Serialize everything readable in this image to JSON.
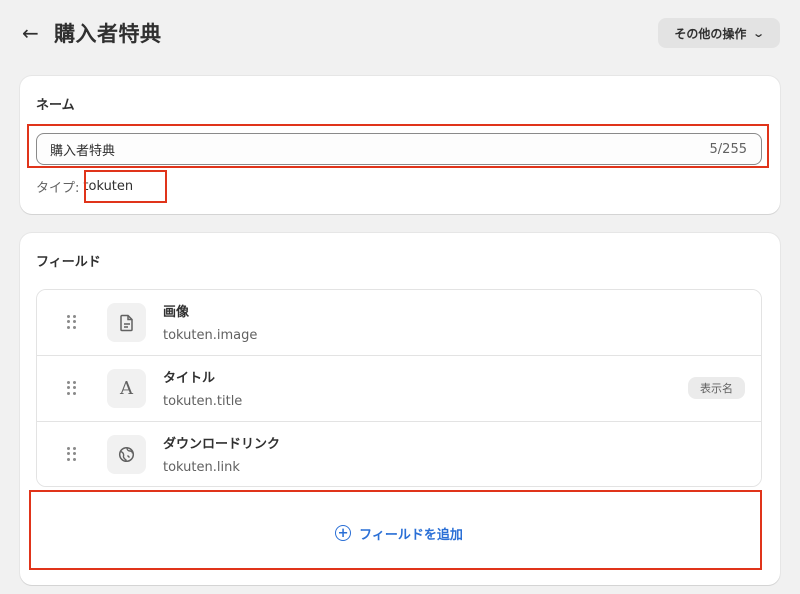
{
  "header": {
    "back_icon": "arrow-left-icon",
    "title": "購入者特典",
    "more_actions_label": "その他の操作",
    "more_actions_icon": "chevron-down-icon"
  },
  "name_card": {
    "title": "ネーム",
    "name_value": "購入者特典",
    "char_counter": "5/255",
    "type_label": "タイプ:",
    "type_value": "tokuten"
  },
  "fields_card": {
    "title": "フィールド",
    "fields": [
      {
        "name": "画像",
        "key": "tokuten.image",
        "icon": "file-icon",
        "badge": ""
      },
      {
        "name": "タイトル",
        "key": "tokuten.title",
        "icon": "text-icon",
        "badge": "表示名"
      },
      {
        "name": "ダウンロードリンク",
        "key": "tokuten.link",
        "icon": "globe-icon",
        "badge": ""
      }
    ],
    "add_field_label": "フィールドを追加",
    "add_field_icon": "plus-circle-icon"
  },
  "colors": {
    "background": "#f1f1f1",
    "card": "#ffffff",
    "accent": "#2a6fd6",
    "highlight": "#e0341a"
  }
}
